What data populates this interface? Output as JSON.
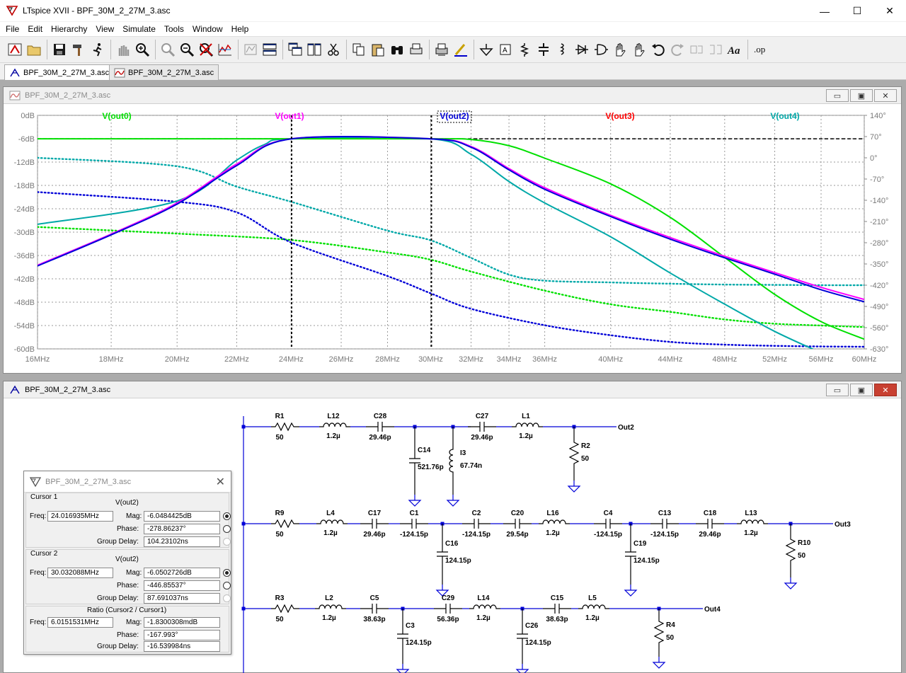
{
  "window": {
    "title": "LTspice XVII - BPF_30M_2_27M_3.asc",
    "minimize": "—",
    "maximize": "☐",
    "close": "✕"
  },
  "menu": [
    {
      "label": "File",
      "key": "F"
    },
    {
      "label": "Edit",
      "key": "E"
    },
    {
      "label": "Hierarchy",
      "key": "H"
    },
    {
      "label": "View",
      "key": "V"
    },
    {
      "label": "Simulate",
      "key": "S"
    },
    {
      "label": "Tools",
      "key": "T"
    },
    {
      "label": "Window",
      "key": "W"
    },
    {
      "label": "Help",
      "key": "H"
    }
  ],
  "toolbar": {
    "icons": [
      "control-panel-icon",
      "open-icon",
      "save-icon",
      "hammer-icon",
      "run-icon",
      "halt-icon",
      "zoom-in-icon",
      "zoom-pan-icon",
      "zoom-out-icon",
      "zoom-cancel-icon",
      "autorange-icon",
      "ftt-icon",
      "tile-horiz-icon",
      "cascade-icon",
      "tile-vert-icon",
      "cut-icon",
      "copy-icon",
      "paste-icon",
      "find-icon",
      "print-setup-icon",
      "print-icon",
      "draw-wire-icon",
      "ground-icon",
      "label-net-icon",
      "resistor-icon",
      "capacitor-icon",
      "inductor-icon",
      "diode-icon",
      "component-icon",
      "move-icon",
      "drag-icon",
      "undo-icon",
      "redo-icon",
      "rotate-icon",
      "mirror-icon",
      "text-icon",
      "spice-directive-icon"
    ]
  },
  "tabs": [
    {
      "label": "BPF_30M_2_27M_3.asc",
      "active": true
    },
    {
      "label": "BPF_30M_2_27M_3.asc",
      "active": false
    }
  ],
  "plot_window": {
    "title": "BPF_30M_2_27M_3.asc",
    "buttons": {
      "min": "▭",
      "restore": "▣",
      "close": "✕"
    }
  },
  "schematic_window": {
    "title": "BPF_30M_2_27M_3.asc",
    "buttons": {
      "min": "▭",
      "restore": "▣",
      "close": "✕"
    }
  },
  "chart_data": {
    "type": "line",
    "title": "",
    "xscale": "log",
    "xlim": [
      16,
      60
    ],
    "x_ticks": [
      "16MHz",
      "18MHz",
      "20MHz",
      "22MHz",
      "24MHz",
      "26MHz",
      "28MHz",
      "30MHz",
      "32MHz",
      "34MHz",
      "36MHz",
      "40MHz",
      "44MHz",
      "48MHz",
      "52MHz",
      "56MHz",
      "60MHz"
    ],
    "x_tick_values": [
      16,
      18,
      20,
      22,
      24,
      26,
      28,
      30,
      32,
      34,
      36,
      40,
      44,
      48,
      52,
      56,
      60
    ],
    "ylim_left": [
      -60,
      0
    ],
    "y_ticks_left": [
      "0dB",
      "-6dB",
      "-12dB",
      "-18dB",
      "-24dB",
      "-30dB",
      "-36dB",
      "-42dB",
      "-48dB",
      "-54dB",
      "-60dB"
    ],
    "y_tick_values_left": [
      0,
      -6,
      -12,
      -18,
      -24,
      -30,
      -36,
      -42,
      -48,
      -54,
      -60
    ],
    "ylim_right": [
      -630,
      140
    ],
    "y_ticks_right": [
      "140°",
      "70°",
      "0°",
      "-70°",
      "-140°",
      "-210°",
      "-280°",
      "-350°",
      "-420°",
      "-490°",
      "-560°",
      "-630°"
    ],
    "y_tick_values_right": [
      140,
      70,
      0,
      -70,
      -140,
      -210,
      -280,
      -350,
      -420,
      -490,
      -560,
      -630
    ],
    "cursors_x": [
      24.016935,
      30.032088
    ],
    "reference_level_db": -6,
    "series": [
      {
        "name": "V(out0)",
        "color": "#00e000",
        "magnitude_db": [
          [
            16,
            -6.02
          ],
          [
            24,
            -6.02
          ],
          [
            30,
            -6.02
          ],
          [
            32,
            -6.2
          ],
          [
            34,
            -7.8
          ],
          [
            36,
            -11
          ],
          [
            40,
            -17.6
          ],
          [
            44,
            -26.2
          ],
          [
            48,
            -36.5
          ],
          [
            52,
            -46
          ],
          [
            56,
            -53
          ],
          [
            60,
            -57.5
          ]
        ],
        "phase_deg": [
          [
            16,
            -228
          ],
          [
            20,
            -250
          ],
          [
            24,
            -271
          ],
          [
            28,
            -312
          ],
          [
            30,
            -336
          ],
          [
            32,
            -375
          ],
          [
            36,
            -438
          ],
          [
            40,
            -483
          ],
          [
            44,
            -508
          ],
          [
            48,
            -533
          ],
          [
            52,
            -547
          ],
          [
            56,
            -553
          ],
          [
            60,
            -558
          ]
        ]
      },
      {
        "name": "V(out1)",
        "color": "#ff00ff",
        "magnitude_db": [
          [
            16,
            -38.5
          ],
          [
            18,
            -30.5
          ],
          [
            20,
            -22.5
          ],
          [
            22,
            -12.5
          ],
          [
            24,
            -6.02
          ],
          [
            30,
            -6.02
          ],
          [
            32,
            -8
          ],
          [
            34,
            -13.7
          ],
          [
            36,
            -18.6
          ],
          [
            40,
            -25.7
          ],
          [
            44,
            -31.4
          ],
          [
            48,
            -36.2
          ],
          [
            52,
            -40.4
          ],
          [
            56,
            -44.2
          ],
          [
            60,
            -47.3
          ]
        ],
        "phase_deg": []
      },
      {
        "name": "V(out2)",
        "color": "#0000d8",
        "magnitude_db": [
          [
            16,
            -38.7
          ],
          [
            18,
            -30.7
          ],
          [
            20,
            -22.8
          ],
          [
            22,
            -12.9
          ],
          [
            24,
            -6.05
          ],
          [
            30,
            -6.05
          ],
          [
            32,
            -8.2
          ],
          [
            34,
            -14
          ],
          [
            36,
            -19
          ],
          [
            40,
            -26
          ],
          [
            44,
            -31.8
          ],
          [
            48,
            -36.6
          ],
          [
            52,
            -40.8
          ],
          [
            56,
            -44.8
          ],
          [
            60,
            -47.9
          ]
        ],
        "phase_deg": [
          [
            16,
            -113
          ],
          [
            20,
            -145
          ],
          [
            22,
            -180
          ],
          [
            24,
            -278.9
          ],
          [
            28,
            -390
          ],
          [
            30,
            -446.9
          ],
          [
            32,
            -498
          ],
          [
            36,
            -552
          ],
          [
            40,
            -585
          ],
          [
            44,
            -607
          ],
          [
            48,
            -616
          ],
          [
            52,
            -620
          ],
          [
            56,
            -622
          ],
          [
            60,
            -623
          ]
        ]
      },
      {
        "name": "V(out3)",
        "color": "#ff0000",
        "magnitude_db": [
          [
            16,
            -6.02
          ],
          [
            60,
            -6.02
          ]
        ],
        "phase_deg": []
      },
      {
        "name": "V(out4)",
        "color": "#00a8a8",
        "magnitude_db": [
          [
            16,
            -28
          ],
          [
            20,
            -22
          ],
          [
            22,
            -11.5
          ],
          [
            23,
            -7.5
          ],
          [
            24,
            -6.02
          ],
          [
            30,
            -6.02
          ],
          [
            32,
            -10
          ],
          [
            34,
            -17
          ],
          [
            36,
            -22.5
          ],
          [
            40,
            -31.2
          ],
          [
            44,
            -40.5
          ],
          [
            48,
            -48.5
          ],
          [
            52,
            -55.5
          ],
          [
            56,
            -61
          ],
          [
            60,
            -66
          ]
        ],
        "phase_deg": [
          [
            16,
            0
          ],
          [
            20,
            -28
          ],
          [
            22,
            -95
          ],
          [
            24,
            -145
          ],
          [
            28,
            -240
          ],
          [
            30,
            -272
          ],
          [
            32,
            -330
          ],
          [
            34,
            -385
          ],
          [
            36,
            -405
          ],
          [
            40,
            -411
          ],
          [
            44,
            -415
          ],
          [
            48,
            -418
          ],
          [
            52,
            -419
          ],
          [
            56,
            -420
          ],
          [
            60,
            -420
          ]
        ]
      }
    ]
  },
  "schematic": {
    "row1": {
      "labels": [
        {
          "text": "R1"
        },
        {
          "text": "50"
        },
        {
          "text": "L12"
        },
        {
          "text": "1.2µ"
        },
        {
          "text": "C28"
        },
        {
          "text": "29.46p"
        },
        {
          "text": "C27"
        },
        {
          "text": "29.46p"
        },
        {
          "text": "L1"
        },
        {
          "text": "1.2µ"
        },
        {
          "text": "C14"
        },
        {
          "text": "521.76p"
        },
        {
          "text": "I3"
        },
        {
          "text": "67.74n"
        },
        {
          "text": "R2"
        },
        {
          "text": "50"
        },
        {
          "text": "Out2"
        }
      ]
    },
    "row2": {
      "labels": [
        {
          "text": "R9"
        },
        {
          "text": "50"
        },
        {
          "text": "L4"
        },
        {
          "text": "1.2µ"
        },
        {
          "text": "C17"
        },
        {
          "text": "29.46p"
        },
        {
          "text": "C1"
        },
        {
          "text": "-124.15p"
        },
        {
          "text": "C2"
        },
        {
          "text": "-124.15p"
        },
        {
          "text": "C20"
        },
        {
          "text": "29.54p"
        },
        {
          "text": "L16"
        },
        {
          "text": "1.2µ"
        },
        {
          "text": "C4"
        },
        {
          "text": "-124.15p"
        },
        {
          "text": "C13"
        },
        {
          "text": "-124.15p"
        },
        {
          "text": "C18"
        },
        {
          "text": "29.46p"
        },
        {
          "text": "L13"
        },
        {
          "text": "1.2µ"
        },
        {
          "text": "C16"
        },
        {
          "text": "124.15p"
        },
        {
          "text": "C19"
        },
        {
          "text": "124.15p"
        },
        {
          "text": "R10"
        },
        {
          "text": "50"
        },
        {
          "text": "Out3"
        }
      ]
    },
    "row3": {
      "labels": [
        {
          "text": "R3"
        },
        {
          "text": "50"
        },
        {
          "text": "L2"
        },
        {
          "text": "1.2µ"
        },
        {
          "text": "C5"
        },
        {
          "text": "38.63p"
        },
        {
          "text": "C29"
        },
        {
          "text": "56.36p"
        },
        {
          "text": "L14"
        },
        {
          "text": "1.2µ"
        },
        {
          "text": "C15"
        },
        {
          "text": "38.63p"
        },
        {
          "text": "L5"
        },
        {
          "text": "1.2µ"
        },
        {
          "text": "C3"
        },
        {
          "text": "124.15p"
        },
        {
          "text": "C26"
        },
        {
          "text": "124.15p"
        },
        {
          "text": "R4"
        },
        {
          "text": "50"
        },
        {
          "text": "Out4"
        }
      ]
    }
  },
  "cursor_dialog": {
    "title": "BPF_30M_2_27M_3.asc",
    "close": "✕",
    "cursor1": {
      "group": "Cursor 1",
      "trace": "V(out2)",
      "freq_label": "Freq:",
      "freq": "24.016935MHz",
      "mag_label": "Mag:",
      "mag": "-6.0484425dB",
      "phase_label": "Phase:",
      "phase": "-278.86237°",
      "gd_label": "Group Delay:",
      "gd": "104.23102ns"
    },
    "cursor2": {
      "group": "Cursor 2",
      "trace": "V(out2)",
      "freq_label": "Freq:",
      "freq": "30.032088MHz",
      "mag_label": "Mag:",
      "mag": "-6.0502726dB",
      "phase_label": "Phase:",
      "phase": "-446.85537°",
      "gd_label": "Group Delay:",
      "gd": "87.691037ns"
    },
    "ratio": {
      "group": "Ratio (Cursor2 / Cursor1)",
      "freq_label": "Freq:",
      "freq": "6.0151531MHz",
      "mag_label": "Mag:",
      "mag": "-1.8300308mdB",
      "phase_label": "Phase:",
      "phase": "-167.993°",
      "gd_label": "Group Delay:",
      "gd": "-16.539984ns"
    }
  }
}
